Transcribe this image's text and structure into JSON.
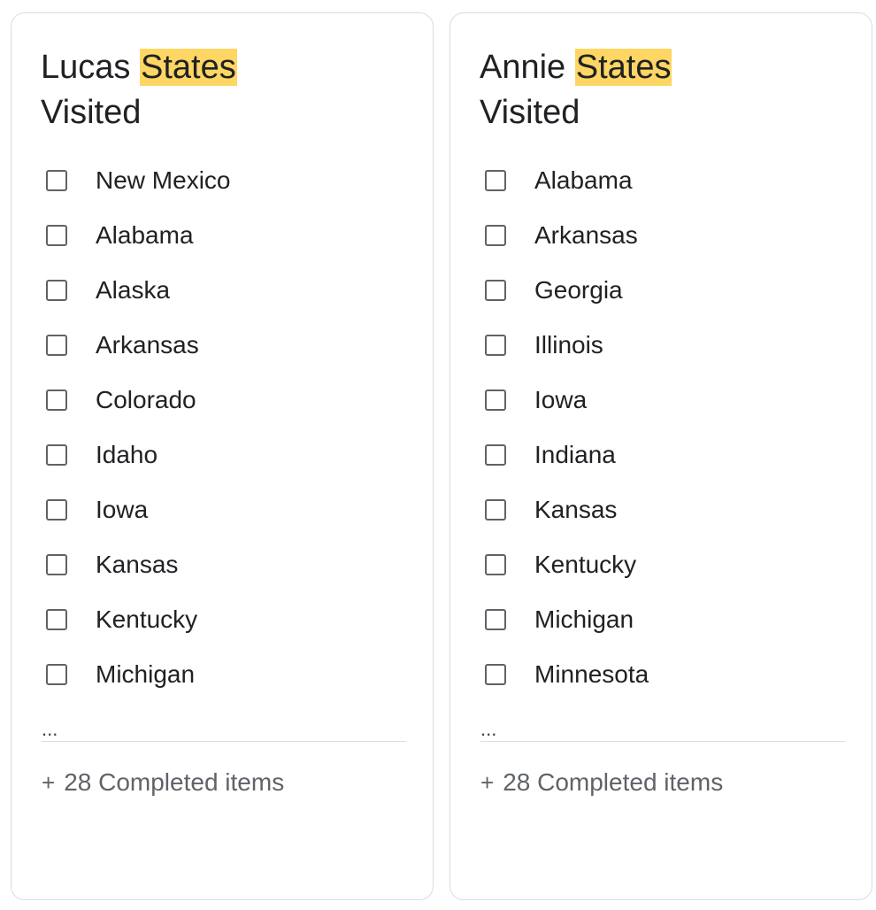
{
  "notes": [
    {
      "title_before": "Lucas ",
      "title_highlight": "States",
      "title_after": "Visited",
      "items": [
        {
          "label": "New Mexico"
        },
        {
          "label": "Alabama"
        },
        {
          "label": "Alaska"
        },
        {
          "label": "Arkansas"
        },
        {
          "label": "Colorado"
        },
        {
          "label": "Idaho"
        },
        {
          "label": "Iowa"
        },
        {
          "label": "Kansas"
        },
        {
          "label": "Kentucky"
        },
        {
          "label": "Michigan"
        }
      ],
      "ellipsis": "...",
      "completed_icon": "+",
      "completed_label": "28 Completed items"
    },
    {
      "title_before": "Annie ",
      "title_highlight": "States",
      "title_after": "Visited",
      "items": [
        {
          "label": "Alabama"
        },
        {
          "label": "Arkansas"
        },
        {
          "label": "Georgia"
        },
        {
          "label": "Illinois"
        },
        {
          "label": "Iowa"
        },
        {
          "label": "Indiana"
        },
        {
          "label": "Kansas"
        },
        {
          "label": "Kentucky"
        },
        {
          "label": "Michigan"
        },
        {
          "label": "Minnesota"
        }
      ],
      "ellipsis": "...",
      "completed_icon": "+",
      "completed_label": "28 Completed items"
    }
  ],
  "colors": {
    "highlight": "#fdd663",
    "text": "#202124",
    "muted": "#5f6368",
    "border": "#dadce0"
  },
  "icons": {
    "checkbox": "checkbox-unchecked-icon",
    "completed": "plus-icon"
  }
}
